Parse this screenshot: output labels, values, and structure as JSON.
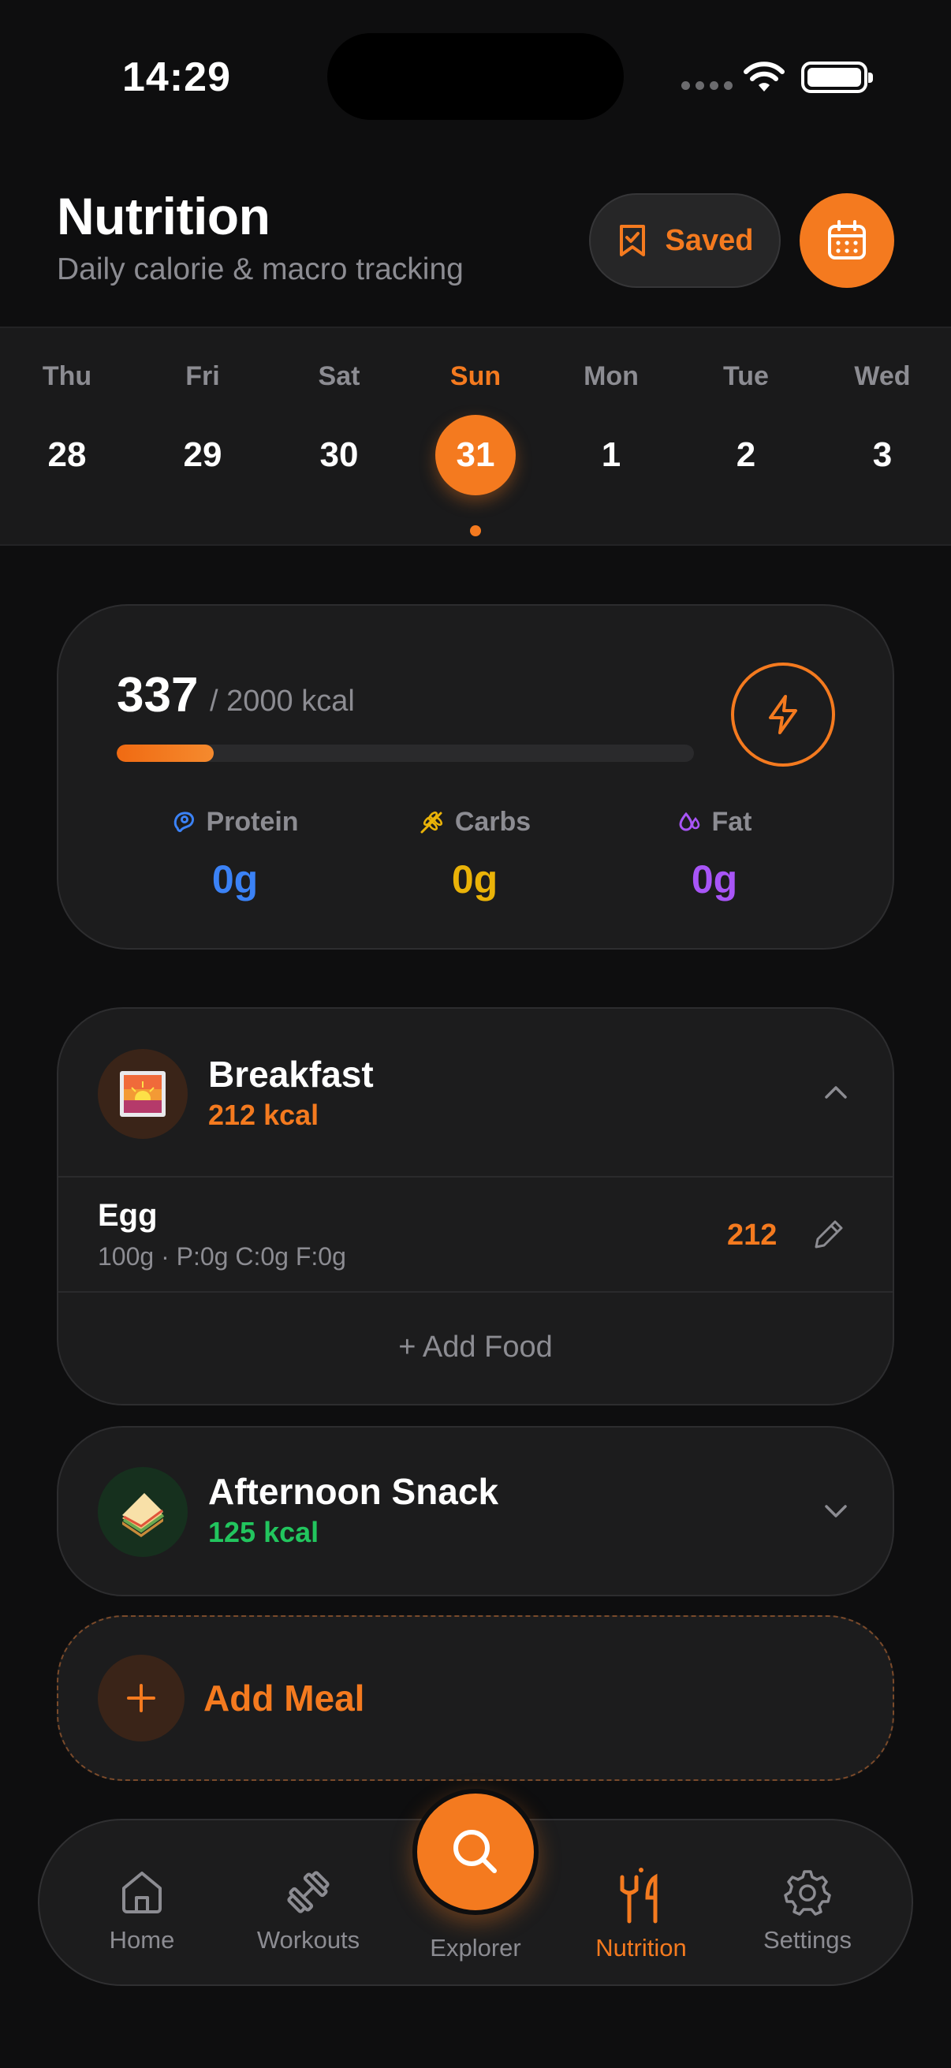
{
  "status_bar": {
    "time": "14:29"
  },
  "header": {
    "title": "Nutrition",
    "subtitle": "Daily calorie & macro tracking",
    "saved_label": "Saved"
  },
  "date_strip": {
    "days": [
      {
        "name": "Thu",
        "num": "28"
      },
      {
        "name": "Fri",
        "num": "29"
      },
      {
        "name": "Sat",
        "num": "30"
      },
      {
        "name": "Sun",
        "num": "31"
      },
      {
        "name": "Mon",
        "num": "1"
      },
      {
        "name": "Tue",
        "num": "2"
      },
      {
        "name": "Wed",
        "num": "3"
      }
    ],
    "selected": "Sun"
  },
  "summary": {
    "calories": "337",
    "target": "/ 2000 kcal",
    "progress_fraction": 0.1685,
    "macros": [
      {
        "label": "Protein",
        "value": "0g",
        "color": "#3b82f6",
        "icon": "protein-icon"
      },
      {
        "label": "Carbs",
        "value": "0g",
        "color": "#eab308",
        "icon": "wheat-icon"
      },
      {
        "label": "Fat",
        "value": "0g",
        "color": "#a855f7",
        "icon": "droplets-icon"
      }
    ]
  },
  "meals": {
    "breakfast": {
      "name": "Breakfast",
      "kcal": "212 kcal",
      "icon": "sunrise-icon",
      "expanded": true,
      "foods": [
        {
          "name": "Egg",
          "meta": "100g · P:0g C:0g F:0g",
          "kcal": "212"
        }
      ],
      "add_food_label": "+ Add Food"
    },
    "snack": {
      "name": "Afternoon Snack",
      "kcal": "125 kcal",
      "icon": "sandwich-icon",
      "expanded": false
    },
    "add_meal_label": "Add Meal"
  },
  "tabbar": {
    "tabs": [
      {
        "label": "Home",
        "icon": "home-icon"
      },
      {
        "label": "Workouts",
        "icon": "dumbbell-icon"
      },
      {
        "label": "Explorer",
        "icon": "search-icon"
      },
      {
        "label": "Nutrition",
        "icon": "utensils-icon"
      },
      {
        "label": "Settings",
        "icon": "gear-icon"
      }
    ],
    "active": "Nutrition"
  },
  "colors": {
    "accent": "#f47a1f",
    "background": "#0e0e0f",
    "card": "#1c1c1d",
    "muted_text": "#8c8c92",
    "snack_kcal": "#22c55e"
  }
}
